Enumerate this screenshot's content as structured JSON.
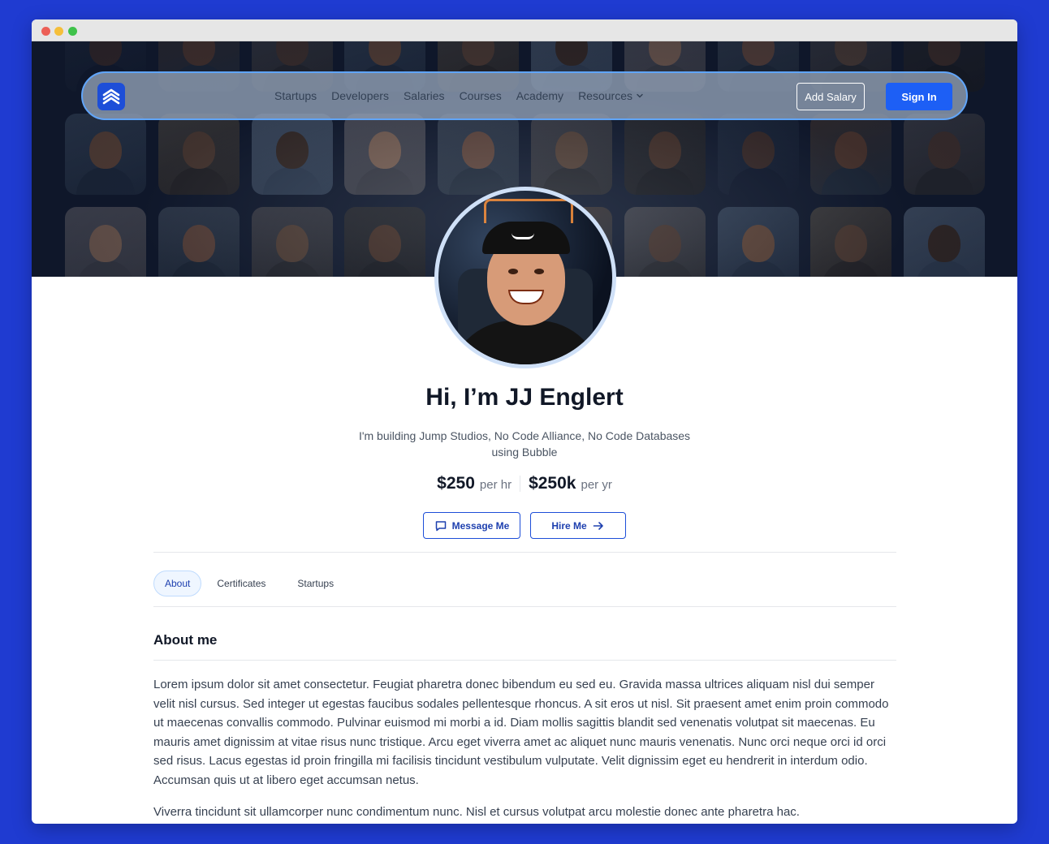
{
  "nav": {
    "links": [
      "Startups",
      "Developers",
      "Salaries",
      "Courses",
      "Academy",
      "Resources"
    ],
    "add_salary_label": "Add Salary",
    "sign_in_label": "Sign In"
  },
  "profile": {
    "name": "Hi, I’m JJ Englert",
    "tagline": "I'm building Jump Studios, No Code Alliance, No Code Databases using Bubble",
    "hourly_rate": "$250",
    "hourly_unit": "per hr",
    "yearly_rate": "$250k",
    "yearly_unit": "per yr",
    "message_label": "Message Me",
    "hire_label": "Hire Me"
  },
  "tabs": [
    "About",
    "Certificates",
    "Startups"
  ],
  "about": {
    "title": "About me",
    "paragraphs": [
      "Lorem ipsum dolor sit amet consectetur. Feugiat pharetra donec bibendum eu sed eu. Gravida massa ultrices aliquam nisl dui semper velit nisl cursus. Sed integer ut egestas faucibus sodales pellentesque rhoncus. A sit eros ut nisl. Sit praesent amet enim proin commodo ut maecenas convallis commodo. Pulvinar euismod mi morbi a id. Diam mollis sagittis blandit sed venenatis volutpat sit maecenas. Eu mauris amet dignissim at vitae risus nunc tristique. Arcu eget viverra amet ac aliquet nunc mauris venenatis. Nunc orci neque orci id orci sed risus. Lacus egestas id proin fringilla mi facilisis tincidunt vestibulum vulputate. Velit dignissim eget eu hendrerit in interdum odio. Accumsan quis ut at libero eget accumsan netus.",
      "Viverra tincidunt sit ullamcorper nunc condimentum nunc. Nisl et cursus volutpat arcu molestie donec ante pharetra hac."
    ]
  },
  "colors": {
    "background": "#1f3bd1",
    "accent": "#1d5ff5",
    "hero_dark": "#0f172a"
  },
  "icons": {
    "logo": "brand-logo-icon",
    "resources_caret": "chevron-down-icon",
    "message": "chat-bubble-icon",
    "hire": "arrow-right-icon"
  }
}
